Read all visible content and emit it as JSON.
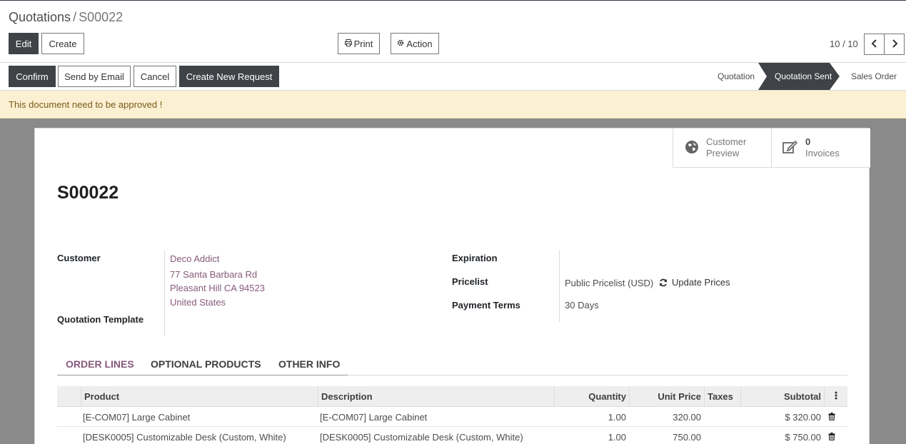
{
  "breadcrumb": {
    "parent": "Quotations",
    "separator": "/",
    "current": "S00022"
  },
  "toolbar": {
    "edit": "Edit",
    "create": "Create",
    "print": "Print",
    "action": "Action"
  },
  "pager": {
    "value": "10 / 10"
  },
  "status_actions": {
    "confirm": "Confirm",
    "send_email": "Send by Email",
    "cancel": "Cancel",
    "create_request": "Create New Request"
  },
  "stages": [
    "Quotation",
    "Quotation Sent",
    "Sales Order"
  ],
  "active_stage": "Quotation Sent",
  "alert": "This document need to be approved !",
  "smart_buttons": {
    "preview": {
      "line1": "Customer",
      "line2": "Preview"
    },
    "invoices": {
      "count": "0",
      "label": "Invoices"
    }
  },
  "record": {
    "name": "S00022",
    "customer_label": "Customer",
    "customer_name": "Deco Addict",
    "address": [
      "77 Santa Barbara Rd",
      "Pleasant Hill CA 94523",
      "United States"
    ],
    "template_label": "Quotation Template",
    "expiration_label": "Expiration",
    "pricelist_label": "Pricelist",
    "pricelist_value": "Public Pricelist (USD)",
    "update_prices": "Update Prices",
    "payment_terms_label": "Payment Terms",
    "payment_terms_value": "30 Days"
  },
  "tabs": [
    "ORDER LINES",
    "OPTIONAL PRODUCTS",
    "OTHER INFO"
  ],
  "lines": {
    "headers": {
      "product": "Product",
      "description": "Description",
      "quantity": "Quantity",
      "unit_price": "Unit Price",
      "taxes": "Taxes",
      "subtotal": "Subtotal"
    },
    "rows": [
      {
        "product": "[E-COM07] Large Cabinet",
        "description": "[E-COM07] Large Cabinet",
        "quantity": "1.00",
        "unit_price": "320.00",
        "taxes": "",
        "subtotal": "$ 320.00"
      },
      {
        "product": "[DESK0005] Customizable Desk (Custom, White)",
        "description": "[DESK0005] Customizable Desk (Custom, White)",
        "quantity": "1.00",
        "unit_price": "750.00",
        "taxes": "",
        "subtotal": "$ 750.00"
      }
    ]
  },
  "icons": {
    "print": "print-icon",
    "action": "gear-icon",
    "prev": "chevron-left-icon",
    "next": "chevron-right-icon",
    "globe": "globe-icon",
    "invoice": "edit-icon",
    "refresh": "refresh-icon",
    "delete": "trash-icon",
    "options": "vertical-dots-icon"
  },
  "colors": {
    "accent": "#875a7b",
    "dark": "#3f4247",
    "alert_bg": "#fcf0d3"
  }
}
